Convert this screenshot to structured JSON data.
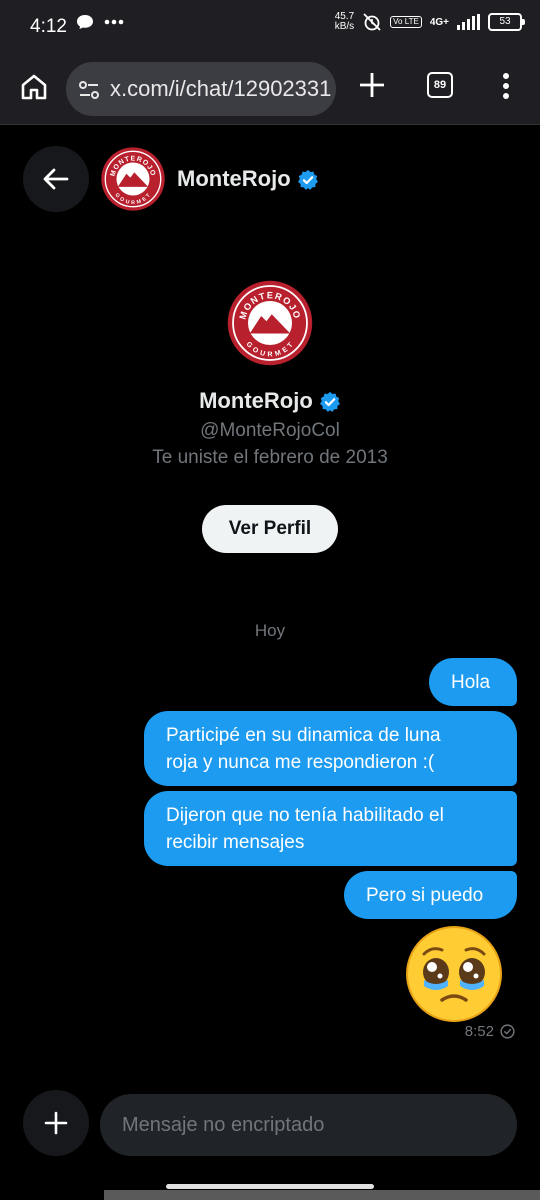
{
  "status_bar": {
    "time": "4:12",
    "net_speed_value": "45.7",
    "net_speed_unit": "kB/s",
    "lte_label": "Vo LTE",
    "network_type": "4G+",
    "battery": "53"
  },
  "browser": {
    "url": "x.com/i/chat/12902331",
    "tab_count": "89"
  },
  "chat_header": {
    "name": "MonteRojo"
  },
  "profile": {
    "name": "MonteRojo",
    "handle": "@MonteRojoCol",
    "joined": "Te uniste el febrero de 2013",
    "view_profile_button": "Ver Perfil"
  },
  "logo_text": {
    "top": "MONTEROJO",
    "bottom": "GOURMET"
  },
  "conversation": {
    "day_label": "Hoy",
    "messages": [
      {
        "text": "Hola"
      },
      {
        "line1": "Participé en su dinamica de luna",
        "line2": "roja y nunca me respondieron :("
      },
      {
        "line1": "Dijeron que no tenía habilitado el",
        "line2": "recibir mensajes"
      },
      {
        "text": "Pero si puedo"
      }
    ],
    "last_sent_time": "8:52"
  },
  "composer": {
    "placeholder": "Mensaje no encriptado"
  },
  "colors": {
    "accent": "#1d9bf0",
    "background": "#000000",
    "logo_red": "#b8202e"
  }
}
